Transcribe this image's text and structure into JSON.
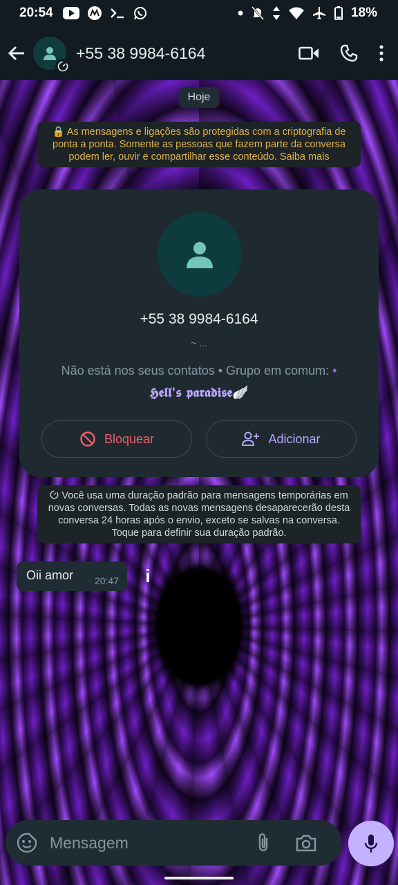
{
  "status_bar": {
    "time": "20:54",
    "battery": "18%",
    "left_icons": [
      "youtube-icon",
      "motorola-icon",
      "terminal-icon",
      "whatsapp-icon"
    ],
    "right_icons": [
      "dot-icon",
      "mute-icon",
      "data-arrows-icon",
      "wifi-icon",
      "airplane-icon",
      "battery-icon"
    ]
  },
  "header": {
    "title": "+55 38 9984-6164",
    "icons": [
      "back-arrow-icon",
      "avatar",
      "video-call-icon",
      "phone-call-icon",
      "more-vert-icon"
    ]
  },
  "date_chip": "Hoje",
  "encryption_notice": "🔒 As mensagens e ligações são protegidas com a criptografia de ponta a ponta. Somente as pessoas que fazem parte da conversa podem ler, ouvir e compartilhar esse conteúdo. Saiba mais",
  "contact_card": {
    "phone": "+55 38 9984-6164",
    "about": "~ ...",
    "info": "Não está nos seus contatos • Grupo em comum:",
    "info_bullet": "•",
    "group_name": "𝕳𝖊𝖑𝖑'𝖘 𝖕𝖆𝖗𝖆𝖉𝖎𝖘𝖊🪽",
    "block_label": "Bloquear",
    "add_label": "Adicionar",
    "block_color": "#f15c6d",
    "add_color": "#b9a4ff"
  },
  "temp_notice": "Você usa uma duração padrão para mensagens temporárias em novas conversas. Todas as novas mensagens desaparecerão desta conversa 24 horas após o envio, exceto se salvas na conversa. Toque para definir sua duração padrão.",
  "message": {
    "text": "Oii amor",
    "time": "20:47"
  },
  "info_glyph": "i",
  "composer": {
    "placeholder": "Mensagem",
    "icons": [
      "sticker-icon",
      "attach-icon",
      "camera-icon",
      "mic-icon"
    ]
  },
  "colors": {
    "accent": "#c3b2ff",
    "header_bg": "#111b21",
    "bubble_bg": "#1f2c33",
    "encryption_text": "#e0b34a"
  }
}
